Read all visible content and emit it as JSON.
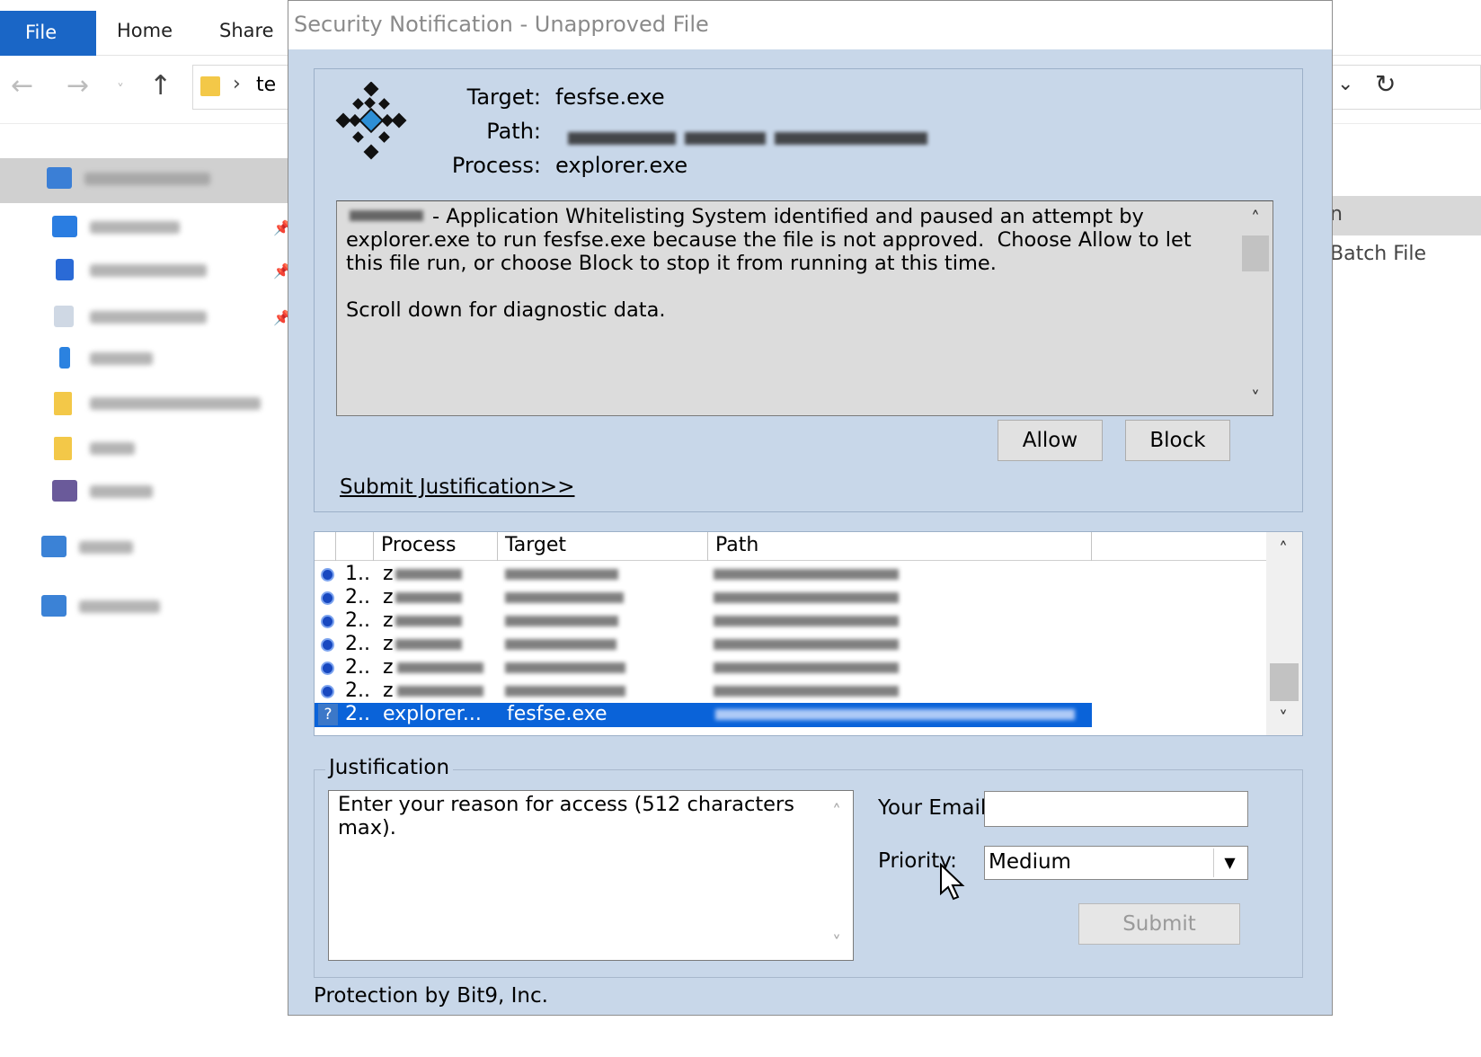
{
  "explorer": {
    "tabs": {
      "file": "File",
      "home": "Home",
      "share": "Share"
    },
    "address_fragment": "te",
    "right_header_fragment": "n",
    "right_item": "Batch File"
  },
  "dialog": {
    "title": "Security Notification - Unapproved File",
    "target_label": "Target:",
    "target_value": "fesfse.exe",
    "path_label": "Path:",
    "process_label": "Process:",
    "process_value": "explorer.exe",
    "message": "- Application Whitelisting System identified and paused an attempt by explorer.exe to run fesfse.exe because the file is not approved.  Choose Allow to let this file run, or choose Block to stop it from running at this time.\n\nScroll down for diagnostic data.",
    "allow_label": "Allow",
    "block_label": "Block",
    "submit_justification": "Submit Justification>>",
    "list": {
      "columns": {
        "process": "Process",
        "target": "Target",
        "path": "Path"
      },
      "rows": [
        {
          "num": "1..",
          "proc": "z"
        },
        {
          "num": "2..",
          "proc": "z"
        },
        {
          "num": "2..",
          "proc": "z"
        },
        {
          "num": "2..",
          "proc": "z"
        },
        {
          "num": "2..",
          "proc": "z"
        },
        {
          "num": "2..",
          "proc": "z"
        }
      ],
      "selected_row": {
        "icon": "?",
        "num": "2..",
        "proc": "explorer...",
        "target": "fesfse.exe"
      }
    },
    "justification": {
      "group_label": "Justification",
      "placeholder": "Enter your reason for access (512 characters max).",
      "email_label": "Your Email:",
      "email_value": "",
      "priority_label": "Priority:",
      "priority_value": "Medium",
      "submit_label": "Submit"
    },
    "footer": "Protection by Bit9, Inc."
  }
}
